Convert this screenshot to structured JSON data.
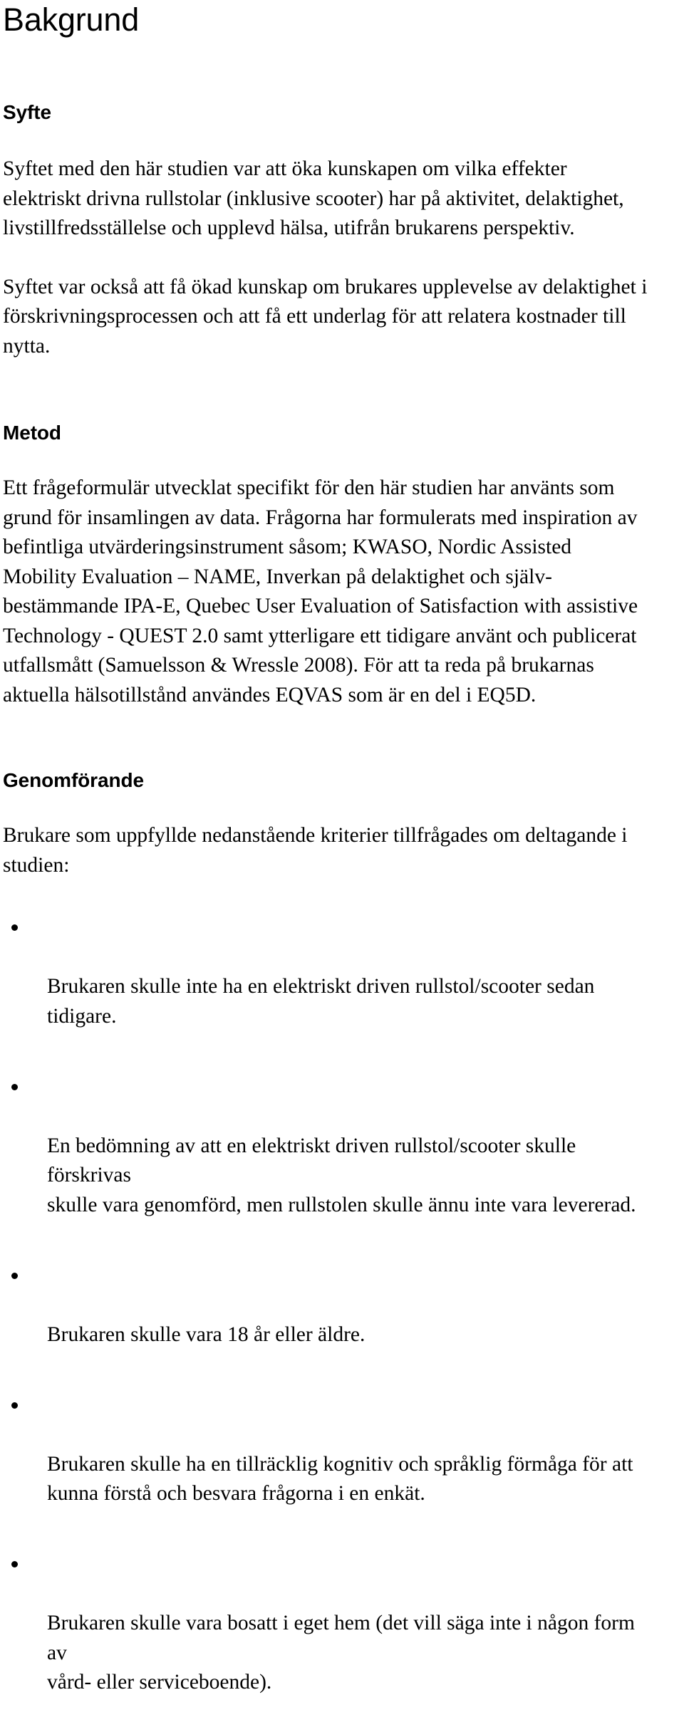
{
  "document": {
    "title": "Bakgrund",
    "background_color": "#ffffff",
    "text_color": "#000000"
  },
  "sections": {
    "syfte": {
      "heading": "Syfte",
      "paragraph_1": "Syftet med den här studien var att öka kunskapen om vilka effekter\nelektriskt drivna rullstolar (inklusive scooter) har på aktivitet, delaktighet,\nlivstillfredsställelse och upplevd hälsa, utifrån brukarens perspektiv.",
      "paragraph_2": "Syftet var också att få ökad kunskap om brukares upplevelse av delaktighet i\nförskrivningsprocessen och att få ett underlag för att relatera kostnader till\nnytta."
    },
    "metod": {
      "heading": "Metod",
      "paragraph_1": "Ett frågeformulär utvecklat specifikt för den här studien har använts som\ngrund för insamlingen av data. Frågorna har formulerats med inspiration av\nbefintliga utvärderingsinstrument såsom; KWASO, Nordic Assisted\nMobility Evaluation – NAME, Inverkan på delaktighet och själv-\nbestämmande IPA-E, Quebec User Evaluation of Satisfaction with assistive\nTechnology - QUEST 2.0 samt ytterligare ett tidigare använt och publicerat\nutfallsmått (Samuelsson & Wressle 2008). För att ta reda på brukarnas\naktuella hälsotillstånd användes EQVAS som är en del i EQ5D."
    },
    "genomforande": {
      "heading": "Genomförande",
      "paragraph_1": "Brukare som uppfyllde nedanstående kriterier tillfrågades om deltagande i\nstudien:",
      "criteria": [
        "Brukaren skulle inte ha en elektriskt driven rullstol/scooter sedan\ntidigare.",
        "En bedömning av att en elektriskt driven rullstol/scooter skulle förskrivas\nskulle vara genomförd, men rullstolen skulle ännu inte vara levererad.",
        "Brukaren skulle vara 18 år eller äldre.",
        "Brukaren skulle ha en tillräcklig kognitiv och språklig förmåga för att\nkunna förstå och besvara frågorna i en enkät.",
        "Brukaren skulle vara bosatt i eget hem (det vill säga inte i någon form av\nvård- eller serviceboende)."
      ]
    }
  }
}
